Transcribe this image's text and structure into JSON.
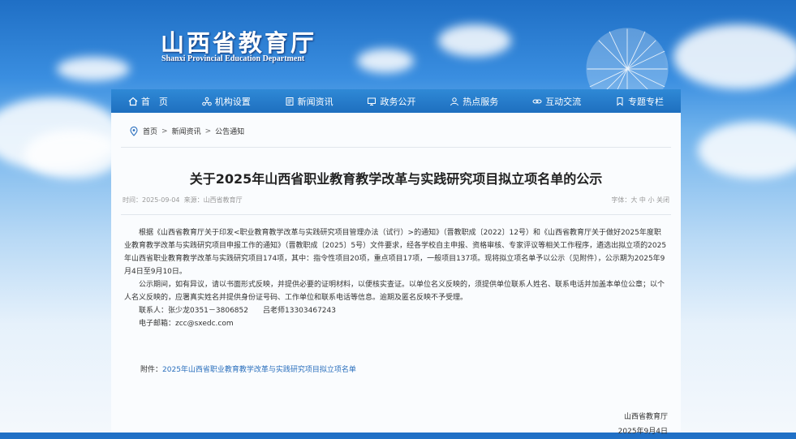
{
  "header": {
    "logo_cn": "山西省教育厅",
    "logo_en": "Shanxi Provincial Education Department"
  },
  "nav": {
    "items": [
      {
        "label": "首　页",
        "icon": "home-icon"
      },
      {
        "label": "机构设置",
        "icon": "org-icon"
      },
      {
        "label": "新闻资讯",
        "icon": "news-icon"
      },
      {
        "label": "政务公开",
        "icon": "gov-icon"
      },
      {
        "label": "热点服务",
        "icon": "service-icon"
      },
      {
        "label": "互动交流",
        "icon": "link-icon"
      },
      {
        "label": "专题专栏",
        "icon": "bookmark-icon"
      }
    ]
  },
  "breadcrumb": {
    "home": "首页",
    "news": "新闻资讯",
    "notice": "公告通知",
    "sep": ">"
  },
  "article": {
    "title": "关于2025年山西省职业教育教学改革与实践研究项目拟立项名单的公示",
    "time": "时间：2025-09-04",
    "source": "来源：山西省教育厅",
    "font_label": "字体：",
    "font_large": "大",
    "font_medium": "中",
    "font_small": "小",
    "close": "关闭",
    "paragraph1": "根据《山西省教育厅关于印发<职业教育教学改革与实践研究项目管理办法（试行）>的通知》（晋教职成〔2022〕12号）和《山西省教育厅关于做好2025年度职业教育教学改革与实践研究项目申报工作的通知》（晋教职成〔2025〕5号）文件要求，经各学校自主申报、资格审核、专家评议等相关工作程序，遴选出拟立项的2025年山西省职业教育教学改革与实践研究项目174项，其中：指令性项目20项，重点项目17项，一般项目137项。现将拟立项名单予以公示（见附件），公示期为2025年9月4日至9月10日。",
    "paragraph2": "公示期间，如有异议，请以书面形式反映，并提供必要的证明材料，以便核实查证。以单位名义反映的，须提供单位联系人姓名、联系电话并加盖本单位公章；以个人名义反映的，应署真实姓名并提供身份证号码、工作单位和联系电话等信息。逾期及匿名反映不予受理。",
    "contact": "联系人：张少龙0351－3806852　　吕老师13303467243",
    "email": "电子邮箱：zcc@sxedc.com",
    "attachment_label": "附件：",
    "attachment_link": "2025年山西省职业教育教学改革与实践研究项目拟立项名单",
    "sign_org": "山西省教育厅",
    "sign_date": "2025年9月4日"
  },
  "colors": {
    "nav_bg": "#1e6fbf",
    "link": "#2a6fbd"
  }
}
